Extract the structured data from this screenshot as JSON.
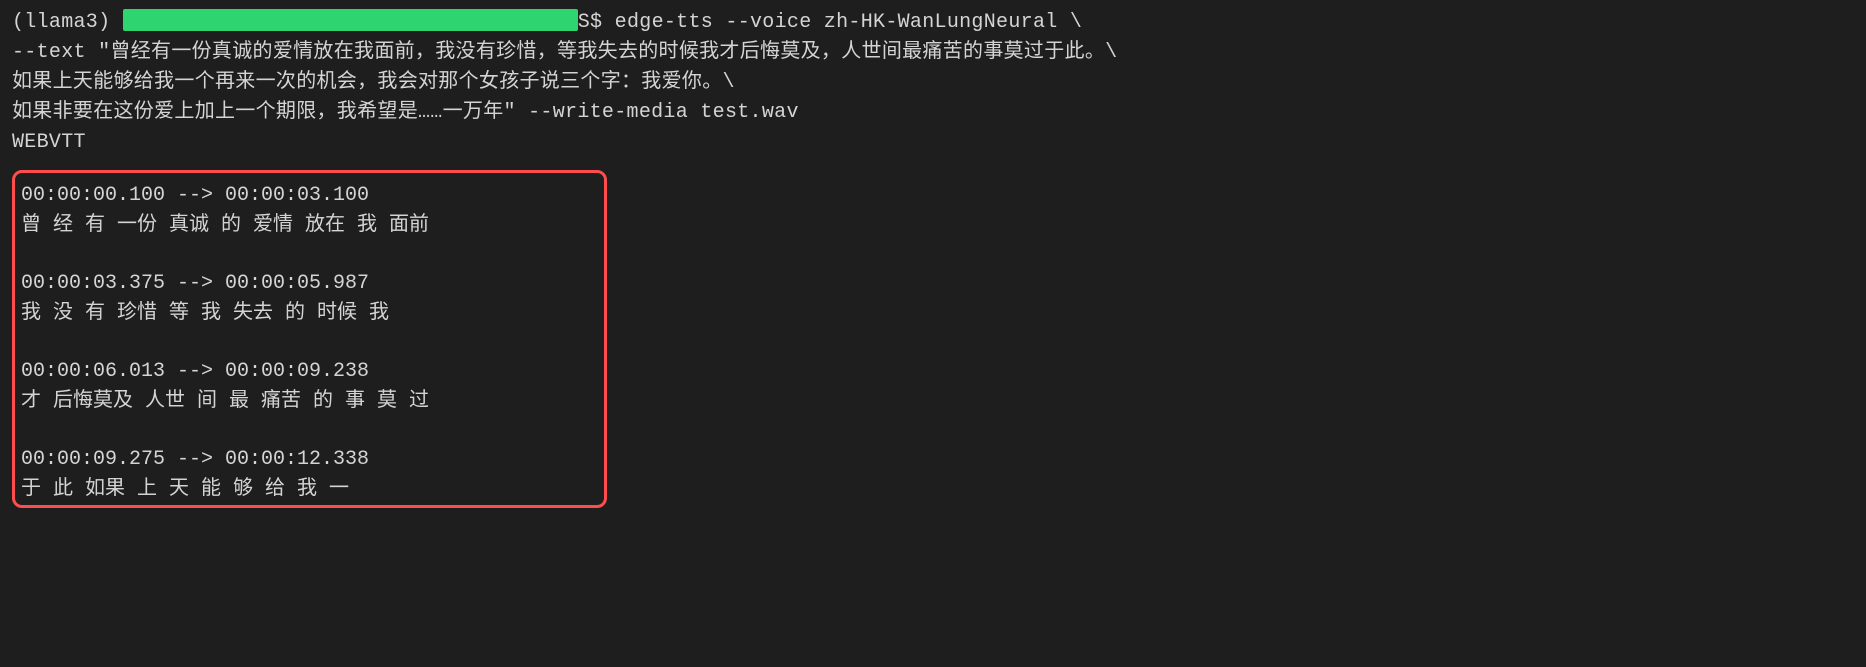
{
  "prompt": {
    "env": "(llama3)",
    "redacted_width": 455,
    "s": "S",
    "char": "$"
  },
  "command": {
    "line1": "edge-tts --voice zh-HK-WanLungNeural \\",
    "line2": "--text \"曾经有一份真诚的爱情放在我面前，我没有珍惜，等我失去的时候我才后悔莫及，人世间最痛苦的事莫过于此。\\",
    "line3": "如果上天能够给我一个再来一次的机会，我会对那个女孩子说三个字：我爱你。\\",
    "line4": "如果非要在这份爱上加上一个期限，我希望是……一万年\" --write-media test.wav"
  },
  "output_header": "WEBVTT",
  "webvtt": [
    {
      "time": "00:00:00.100 --> 00:00:03.100",
      "text": "曾 经 有 一份 真诚 的 爱情 放在 我 面前"
    },
    {
      "time": "00:00:03.375 --> 00:00:05.987",
      "text": "我 没 有 珍惜 等 我 失去 的 时候 我"
    },
    {
      "time": "00:00:06.013 --> 00:00:09.238",
      "text": "才 后悔莫及 人世 间 最 痛苦 的 事 莫 过"
    },
    {
      "time": "00:00:09.275 --> 00:00:12.338",
      "text": "于 此 如果 上 天 能 够 给 我 一"
    }
  ]
}
